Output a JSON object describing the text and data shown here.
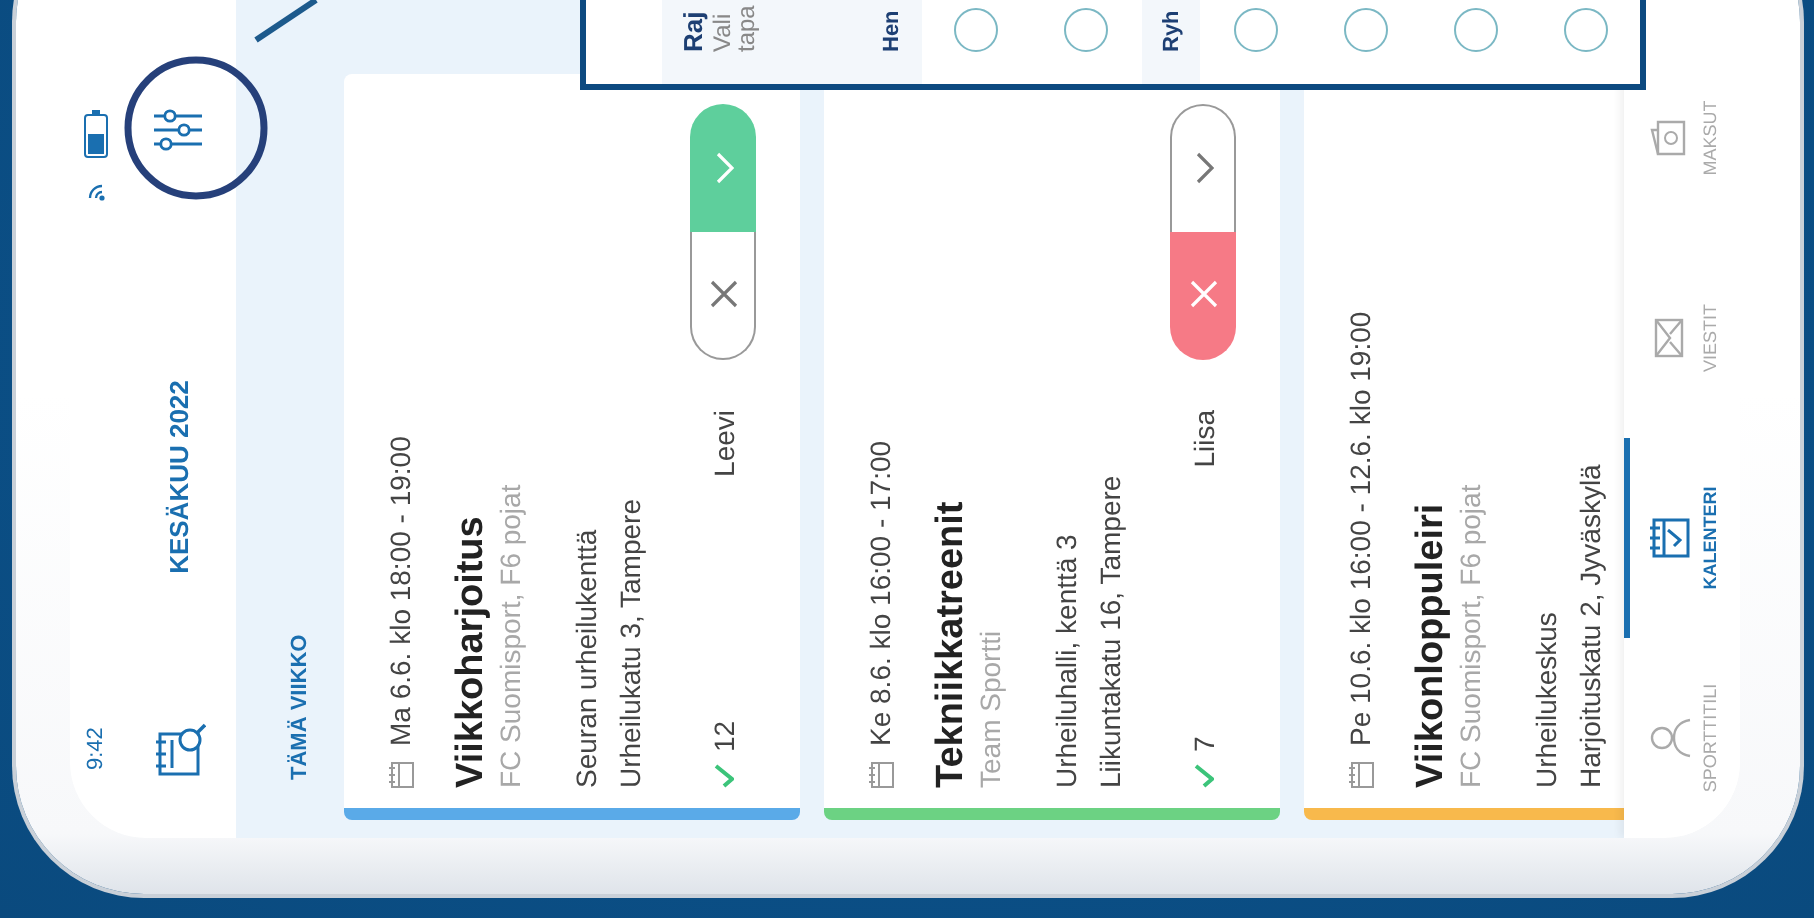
{
  "status_bar": {
    "time": "9:42"
  },
  "header": {
    "title": "KESÄKUU 2022"
  },
  "section_label": "TÄMÄ VIIKKO",
  "cards": [
    {
      "date": "Ma 6.6. klo 18:00 - 19:00",
      "title": "Viikkoharjoitus",
      "organizer": "FC Suomisport, F6 pojat",
      "address": [
        "Seuran urheilukenttä",
        "Urheilukatu 3, Tampere"
      ],
      "color": "#5aaae8",
      "attending": "12",
      "person": "Leevi",
      "accepted": true,
      "declined": false
    },
    {
      "date": "Ke 8.6. klo 16:00 - 17:00",
      "title": "Tekniikkatreenit",
      "organizer": "Team Sportti",
      "address": [
        "Urheiluhalli, kenttä 3",
        "Liikuntakatu 16, Tampere"
      ],
      "color": "#6cd283",
      "attending": "7",
      "person": "Liisa",
      "accepted": false,
      "declined": true
    },
    {
      "date": "Pe 10.6. klo 16:00 - 12.6. klo 19:00",
      "title": "Viikonloppuleiri",
      "organizer": "FC Suomisport, F6 pojat",
      "address": [
        "Urheilukeskus",
        "Harjoituskatu 2, Jyväskylä"
      ],
      "color": "#f8b94c"
    }
  ],
  "bottom_nav": [
    {
      "label": "SPORTTITILI",
      "selected": false
    },
    {
      "label": "KALENTERI",
      "selected": true
    },
    {
      "label": "VIESTIT",
      "selected": false
    },
    {
      "label": "MAKSUT",
      "selected": false
    }
  ],
  "filter_popup": {
    "rows": [
      {
        "kind": "title",
        "title": "Raj",
        "lines": [
          "Vali",
          "tapa"
        ]
      },
      {
        "kind": "heading",
        "text": "Hen"
      },
      {
        "kind": "option",
        "selected": false
      },
      {
        "kind": "option",
        "selected": false
      },
      {
        "kind": "heading",
        "text": "Ryh"
      },
      {
        "kind": "option",
        "selected": false
      },
      {
        "kind": "option",
        "selected": false
      },
      {
        "kind": "option",
        "selected": false
      },
      {
        "kind": "option",
        "selected": false
      }
    ]
  }
}
